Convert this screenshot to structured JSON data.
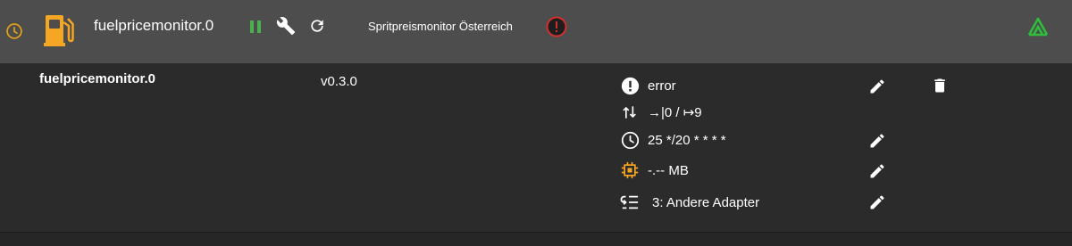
{
  "header": {
    "instance_title": "fuelpricemonitor.0",
    "description": "Spritpreismonitor Österreich",
    "icons": [
      "clock-icon",
      "fuel-pump-icon",
      "pause-icon",
      "wrench-icon",
      "refresh-icon",
      "error-icon",
      "sentry-icon"
    ],
    "colors": {
      "clock": "#e8a317",
      "fuel": "#f5a623",
      "pause": "#4caf50",
      "error_ring": "#d32f2f",
      "sentry": "#2fbd3d"
    }
  },
  "instance": {
    "name": "fuelpricemonitor.0",
    "version": "v0.3.0"
  },
  "details": {
    "status": "error",
    "events": "→|0 / ↦9",
    "schedule": "25 */20 * * * *",
    "memory": "-.-- MB",
    "group": "3: Andere Adapter"
  },
  "colors": {
    "header_bg": "#4d4d4d",
    "content_bg": "#2b2b2b",
    "accent_orange": "#f5a623"
  }
}
